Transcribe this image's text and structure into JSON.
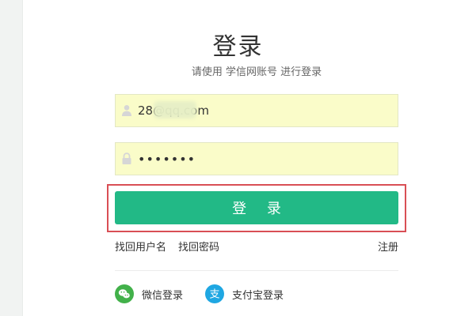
{
  "page": {
    "title": "登录",
    "subtitle": "请使用 学信网账号 进行登录"
  },
  "form": {
    "email_value": "28@qq.com",
    "password_value": "•••••••"
  },
  "buttons": {
    "login_label": "登 录"
  },
  "links": {
    "recover_username": "找回用户名",
    "recover_password": "找回密码",
    "register": "注册"
  },
  "social_login": {
    "wechat_label": "微信登录",
    "alipay_label": "支付宝登录"
  },
  "icons": {
    "email_field": "user-icon",
    "password_field": "lock-icon",
    "wechat": "wechat-icon",
    "alipay": "alipay-icon"
  },
  "colors": {
    "primary": "#22b986",
    "highlight": "#d94f55",
    "input_bg": "#fafcc9"
  }
}
